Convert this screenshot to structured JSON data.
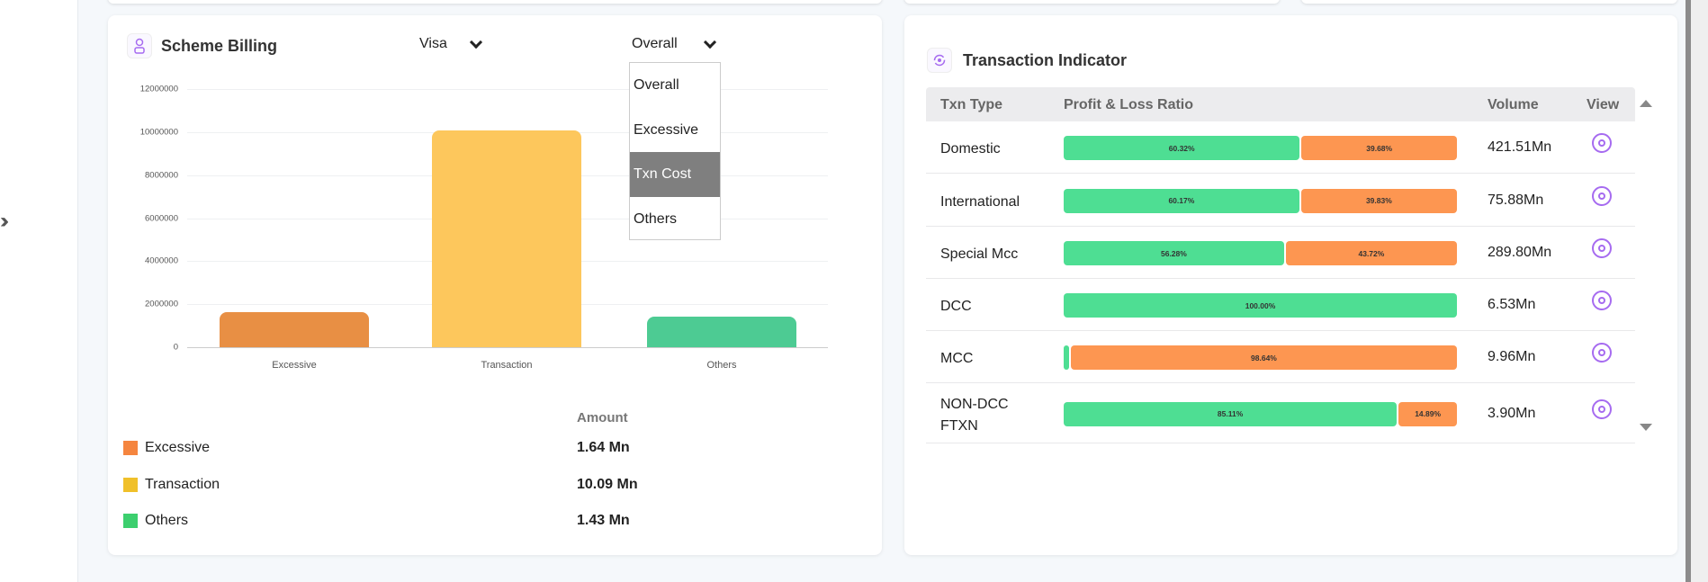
{
  "sidebar": {
    "expand_icon": "double-chevron-right"
  },
  "scheme_billing": {
    "title": "Scheme Billing",
    "scheme_select": "Visa",
    "type_select": "Overall",
    "dropdown_options": [
      "Overall",
      "Excessive",
      "Txn Cost",
      "Others"
    ],
    "highlighted_option": "Txn Cost",
    "amount_header": "Amount",
    "legend": [
      {
        "label": "Excessive",
        "amount": "1.64 Mn",
        "color": "#f5853f"
      },
      {
        "label": "Transaction",
        "amount": "10.09 Mn",
        "color": "#f0c02a"
      },
      {
        "label": "Others",
        "amount": "1.43 Mn",
        "color": "#3ccf6e"
      }
    ]
  },
  "chart_data": {
    "type": "bar",
    "categories": [
      "Excessive",
      "Transaction",
      "Others"
    ],
    "values": [
      1640000,
      10090000,
      1430000
    ],
    "colors": [
      "#e88f44",
      "#fdc75c",
      "#4dcb93"
    ],
    "yticks": [
      "0",
      "2000000",
      "4000000",
      "6000000",
      "8000000",
      "10000000",
      "12000000"
    ],
    "ylim": [
      0,
      12000000
    ],
    "title": "",
    "xlabel": "",
    "ylabel": ""
  },
  "transaction_indicator": {
    "title": "Transaction Indicator",
    "headers": {
      "type": "Txn Type",
      "ratio": "Profit & Loss Ratio",
      "volume": "Volume",
      "view": "View"
    },
    "rows": [
      {
        "type": "Domestic",
        "profit": 60.32,
        "loss": 39.68,
        "profit_label": "60.32%",
        "loss_label": "39.68%",
        "volume": "421.51Mn"
      },
      {
        "type": "International",
        "profit": 60.17,
        "loss": 39.83,
        "profit_label": "60.17%",
        "loss_label": "39.83%",
        "volume": "75.88Mn"
      },
      {
        "type": "Special Mcc",
        "profit": 56.28,
        "loss": 43.72,
        "profit_label": "56.28%",
        "loss_label": "43.72%",
        "volume": "289.80Mn"
      },
      {
        "type": "DCC",
        "profit": 100,
        "loss": 0,
        "profit_label": "100.00%",
        "loss_label": "",
        "volume": "6.53Mn"
      },
      {
        "type": "MCC",
        "profit": 1.36,
        "loss": 98.64,
        "profit_label": "",
        "loss_label": "98.64%",
        "volume": "9.96Mn"
      },
      {
        "type": "NON-DCC FTXN",
        "profit": 85.11,
        "loss": 14.89,
        "profit_label": "85.11%",
        "loss_label": "14.89%",
        "volume": "3.90Mn"
      }
    ]
  }
}
